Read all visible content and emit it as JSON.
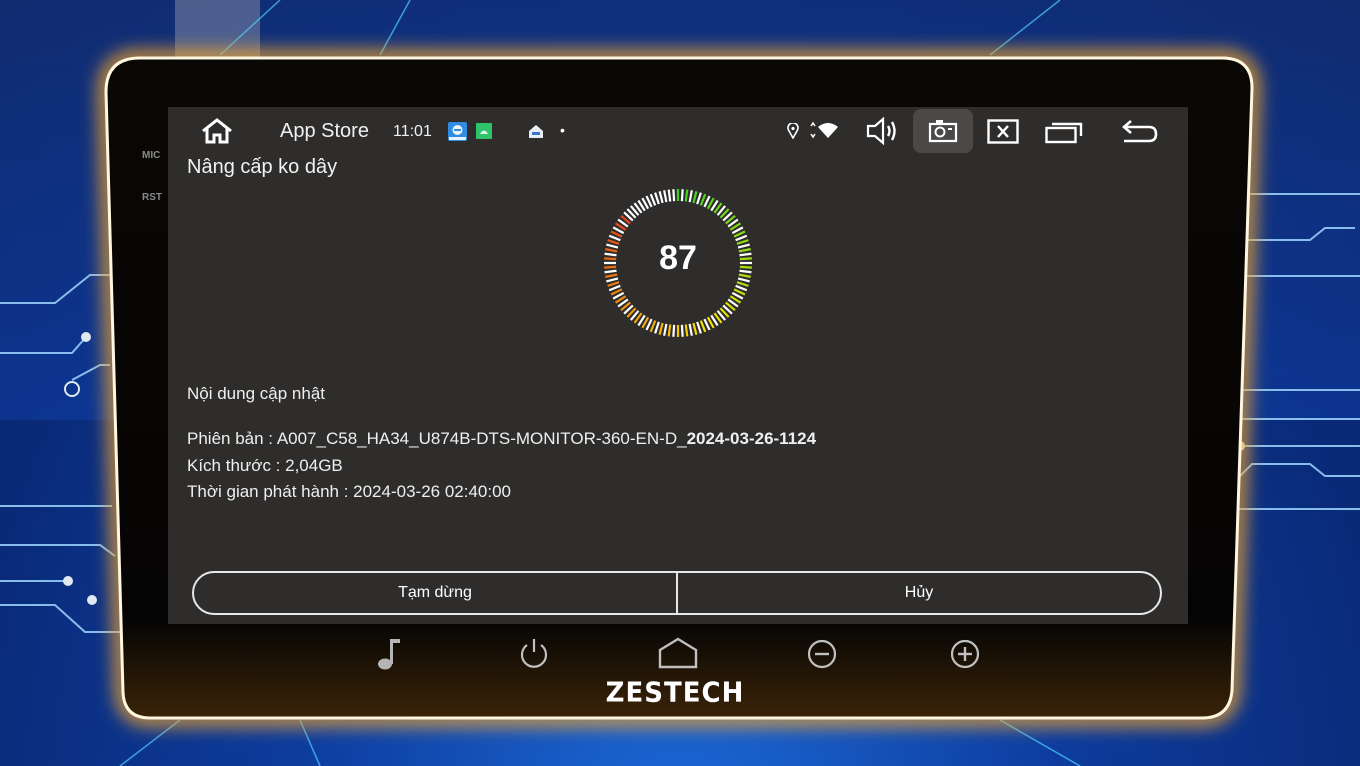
{
  "statusbar": {
    "app_title": "App Store",
    "time": "11:01",
    "icons": [
      "home-icon",
      "teamviewer-app-icon",
      "android-app-icon",
      "car-app-icon",
      "dot-indicator",
      "location-icon",
      "wifi-icon",
      "volume-icon",
      "screenshot-icon",
      "close-window-icon",
      "recent-apps-icon",
      "back-icon"
    ]
  },
  "page": {
    "title": "Nâng cấp ko dây",
    "progress_value": "87",
    "progress_percent": 87
  },
  "update": {
    "section_title": "Nội dung cập nhật",
    "version_label": "Phiên bản : ",
    "version_value": "A007_C58_HA34_U874B-DTS-MONITOR-360-EN-D_",
    "version_date": "2024-03-26-1124",
    "size": "Kích thước : 2,04GB",
    "release_time": "Thời gian phát hành : 2024-03-26 02:40:00"
  },
  "buttons": {
    "pause": "Tạm dừng",
    "cancel": "Hủy"
  },
  "device": {
    "mic_label": "MIC",
    "rst_label": "RST",
    "brand": "ZESTECH",
    "hw_keys": [
      "music-icon",
      "power-icon",
      "home-key-icon",
      "volume-down-icon",
      "volume-up-icon"
    ]
  },
  "colors": {
    "screen_bg": "#2e2d2c",
    "gauge_start": "#e8421c",
    "gauge_mid": "#f5e000",
    "gauge_end": "#38d421",
    "glow": "#f0a020"
  }
}
